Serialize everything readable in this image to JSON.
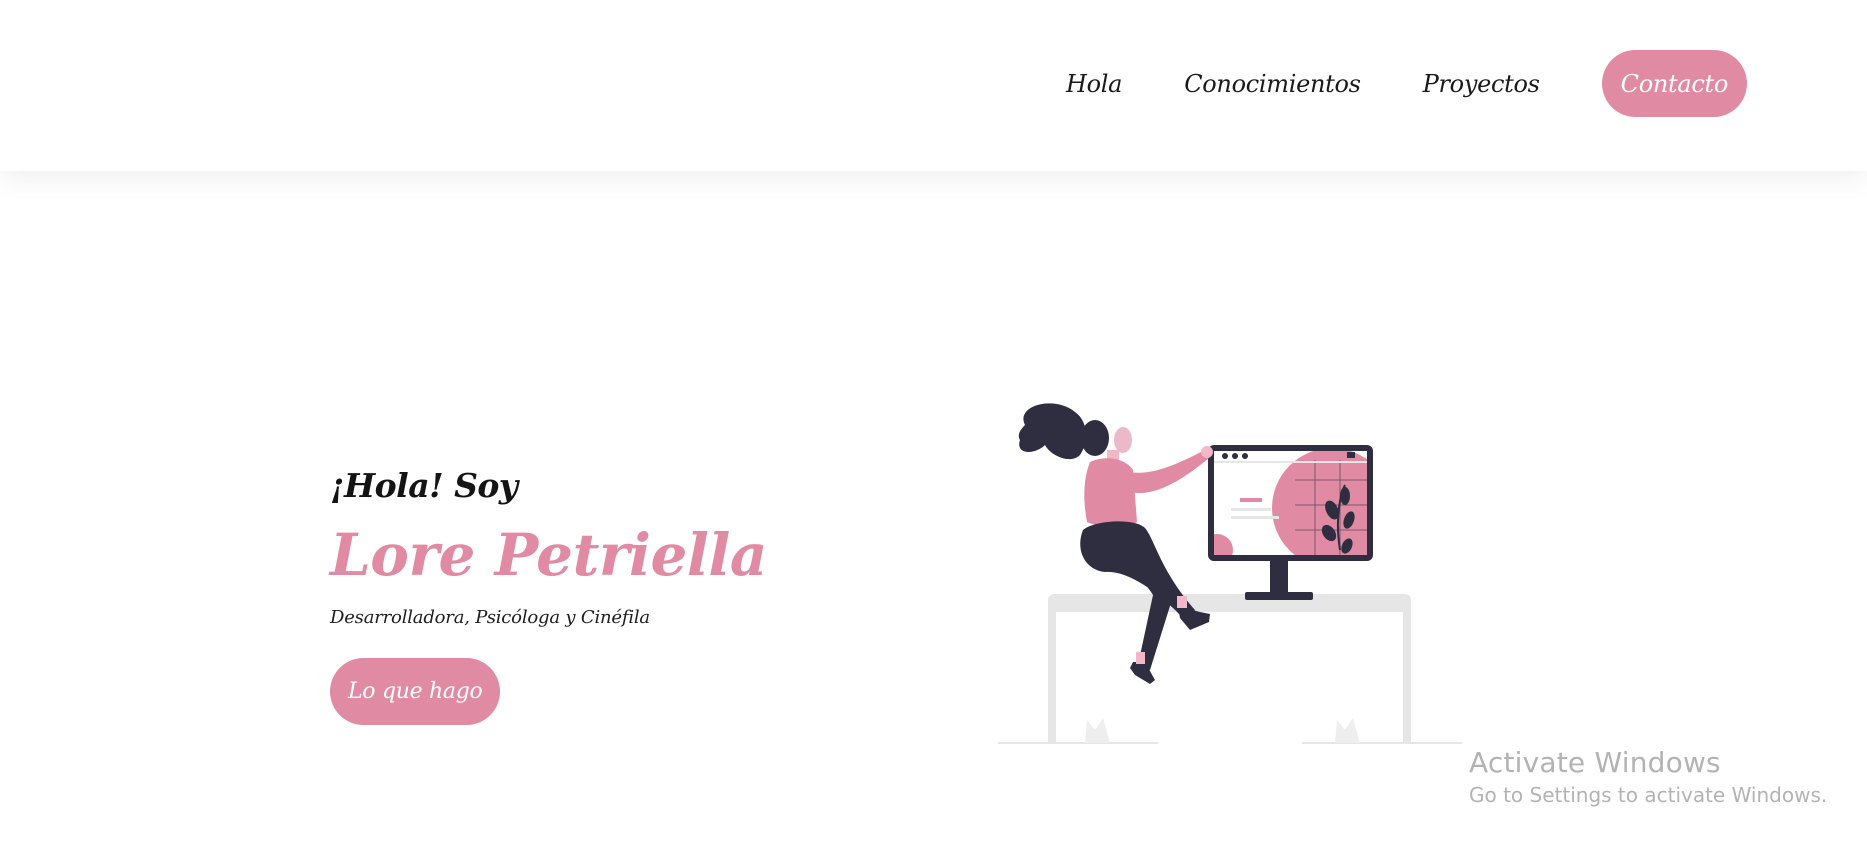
{
  "nav": {
    "items": [
      {
        "label": "Hola"
      },
      {
        "label": "Conocimientos"
      },
      {
        "label": "Proyectos"
      }
    ],
    "cta_label": "Contacto"
  },
  "hero": {
    "greeting": "¡Hola! Soy",
    "name": "Lore Petriella",
    "tagline": "Desarrolladora, Psicóloga y Cinéfila",
    "button_label": "Lo que hago"
  },
  "illustration": {
    "icon": "woman-at-computer-illustration"
  },
  "watermark": {
    "title": "Activate Windows",
    "subtitle": "Go to Settings to activate Windows."
  },
  "colors": {
    "accent": "#e08ba3",
    "dark": "#2f2e41",
    "text": "#1d1d1f",
    "muted_gray": "#e6e6e6"
  }
}
